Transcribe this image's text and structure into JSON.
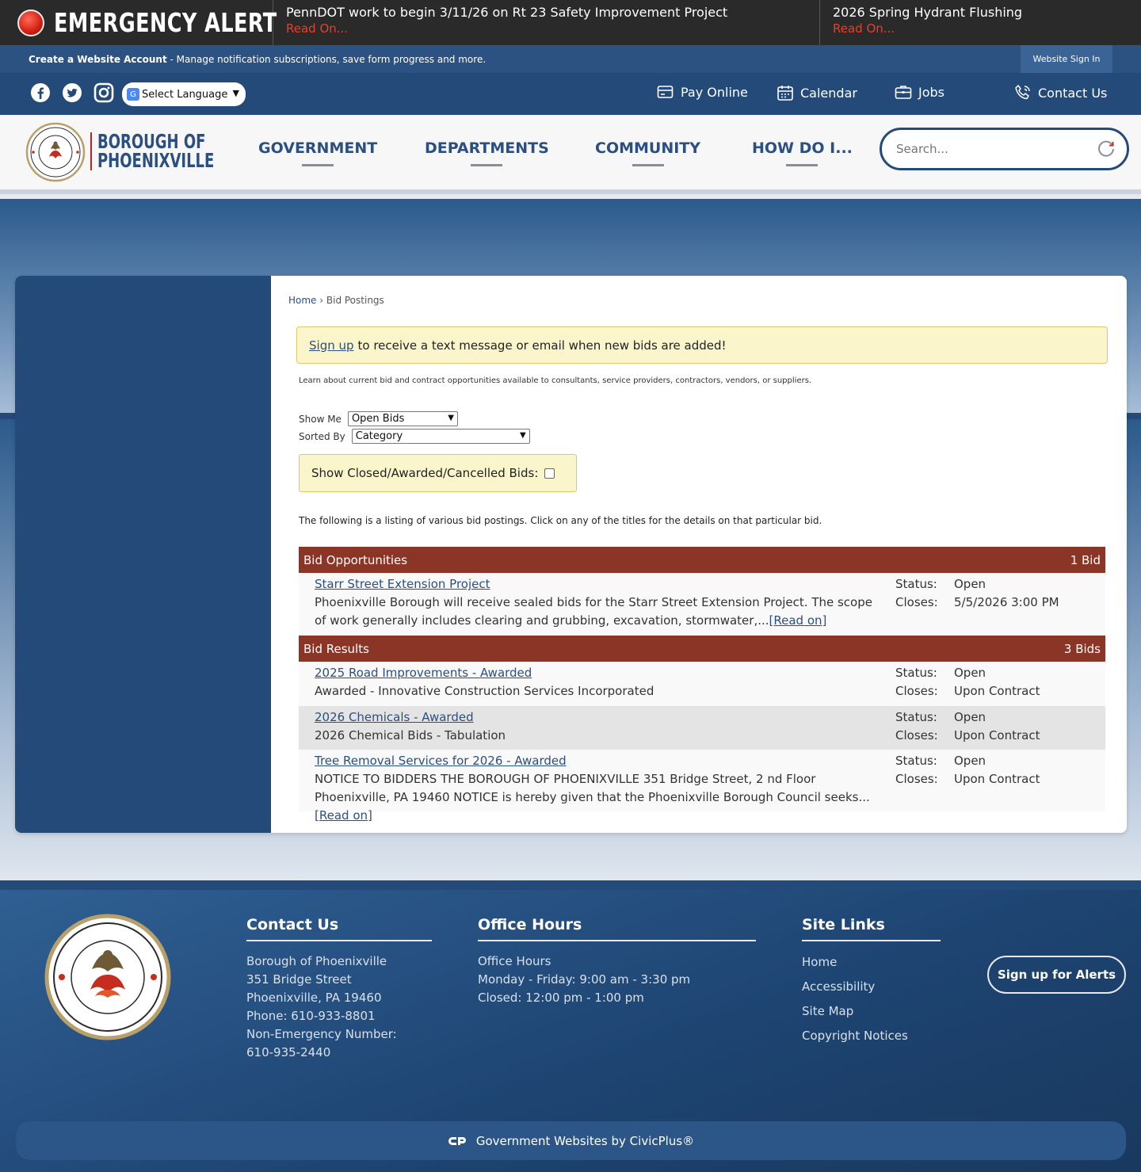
{
  "alert": {
    "title": "EMERGENCY ALERT",
    "items": [
      {
        "text": "PennDOT work to begin 3/11/26 on Rt 23 Safety Improvement Project",
        "link": "Read On..."
      },
      {
        "text": "2026 Spring Hydrant Flushing",
        "link": "Read On..."
      }
    ]
  },
  "account": {
    "bold": "Create a Website Account",
    "text": " - Manage notification subscriptions, save form progress and more.",
    "signin": "Website Sign In"
  },
  "utility": {
    "language": "Select Language",
    "links": {
      "pay": "Pay Online",
      "calendar": "Calendar",
      "jobs": "Jobs",
      "contact": "Contact Us"
    }
  },
  "header": {
    "logo_line1": "BOROUGH OF",
    "logo_line2": "PHOENIXVILLE",
    "nav": [
      "GOVERNMENT",
      "DEPARTMENTS",
      "COMMUNITY",
      "HOW DO I..."
    ],
    "search_placeholder": "Search..."
  },
  "content": {
    "breadcrumb_home": "Home",
    "breadcrumb_sep": " › ",
    "breadcrumb_current": "Bid Postings",
    "signup_link": "Sign up",
    "signup_text": "to receive a text message or email when new bids are added!",
    "intro": "Learn about current bid and contract opportunities available to consultants, service providers, contractors, vendors, or suppliers.",
    "show_me_label": "Show Me",
    "show_me_value": "Open Bids",
    "sorted_by_label": "Sorted By",
    "sorted_by_value": "Category",
    "closed_label": "Show Closed/Awarded/Cancelled Bids:",
    "listing_text": "The following is a listing of various bid postings. Click on any of the titles for the details on that particular bid.",
    "status_label": "Status:",
    "closes_label": "Closes:",
    "read_on": "Read on",
    "sections": [
      {
        "name": "Bid Opportunities",
        "count": "1 Bid",
        "bids": [
          {
            "title": "Starr Street Extension Project",
            "desc": "Phoenixville Borough will receive sealed bids for the Starr Street Extension Project. The scope of work generally includes clearing and grubbing, excavation, stormwater,...",
            "status": "Open",
            "closes": "5/5/2026 3:00 PM"
          }
        ]
      },
      {
        "name": "Bid Results",
        "count": "3 Bids",
        "bids": [
          {
            "title": "2025 Road Improvements - Awarded",
            "desc": "Awarded - Innovative Construction Services Incorporated",
            "status": "Open",
            "closes": "Upon Contract"
          },
          {
            "title": "2026 Chemicals - Awarded",
            "desc": "2026 Chemical Bids - Tabulation",
            "status": "Open",
            "closes": "Upon Contract"
          },
          {
            "title": "Tree Removal Services for 2026 - Awarded",
            "desc": "NOTICE TO BIDDERS THE BOROUGH OF PHOENIXVILLE 351 Bridge Street, 2 nd Floor Phoenixville, PA 19460 NOTICE is hereby given that the Phoenixville Borough Council seeks...",
            "status": "Open",
            "closes": "Upon Contract"
          }
        ]
      }
    ]
  },
  "footer": {
    "contact_title": "Contact Us",
    "contact_lines": [
      "Borough of Phoenixville",
      "351 Bridge Street",
      "Phoenixville, PA 19460",
      "Phone: 610-933-8801",
      "Non-Emergency Number:",
      "610-935-2440"
    ],
    "hours_title": "Office Hours",
    "hours_lines": [
      "Office Hours",
      "Monday - Friday: 9:00 am - 3:30 pm",
      "Closed: 12:00 pm - 1:00 pm"
    ],
    "links_title": "Site Links",
    "links": [
      "Home",
      "Accessibility",
      "Site Map",
      "Copyright Notices"
    ],
    "alerts_button": "Sign up for Alerts",
    "civic": "Government Websites by CivicPlus®"
  },
  "colors": {
    "brand_blue": "#234a78",
    "bid_header_red": "#8b3527",
    "alert_red": "#e5402b",
    "notice_yellow": "#fbf5cc"
  }
}
